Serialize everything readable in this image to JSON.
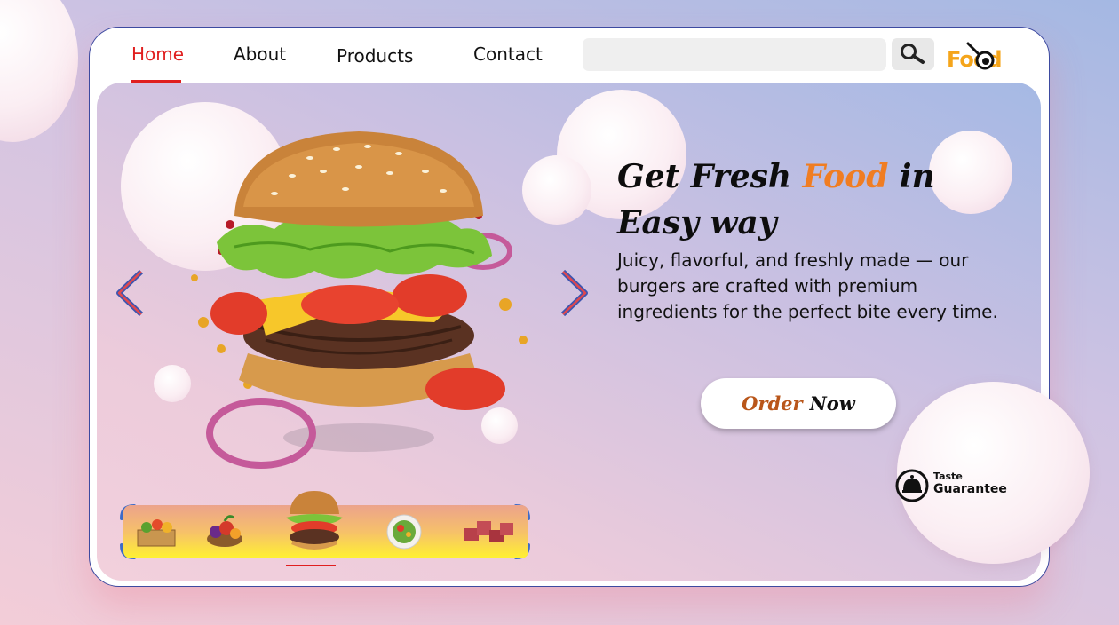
{
  "nav": {
    "items": [
      {
        "label": "Home",
        "active": true
      },
      {
        "label": "About"
      },
      {
        "label": "Products"
      },
      {
        "label": "Contact"
      }
    ],
    "search": {
      "placeholder": "",
      "icon": "magnifier-icon"
    },
    "logo": {
      "text": "Food",
      "icon": "pan-spoon-icon",
      "color": "#f5a51b"
    }
  },
  "hero": {
    "headline": {
      "part1": "Get Fresh ",
      "accent": "Food",
      "part2": " in Easy way"
    },
    "description": "Juicy, flavorful, and freshly made — our burgers are crafted with premium ingredients for the perfect bite every time.",
    "order_button": {
      "word1": "Order",
      "word2": "Now"
    },
    "main_image": "burger-illustration",
    "arrows": {
      "prev": "chevron-left-icon",
      "next": "chevron-right-icon"
    }
  },
  "carousel": {
    "thumbnails": [
      "vegetable-crate",
      "fruit-basket",
      "burger",
      "salad-bowl",
      "meat-cubes"
    ],
    "active_index": 2
  },
  "badge": {
    "line1": "Taste",
    "line2": "Guarantee",
    "icon": "food-dome-icon"
  },
  "colors": {
    "accent_orange": "#f07d22",
    "nav_active": "#e01f1f",
    "border": "#3d4aa0"
  }
}
